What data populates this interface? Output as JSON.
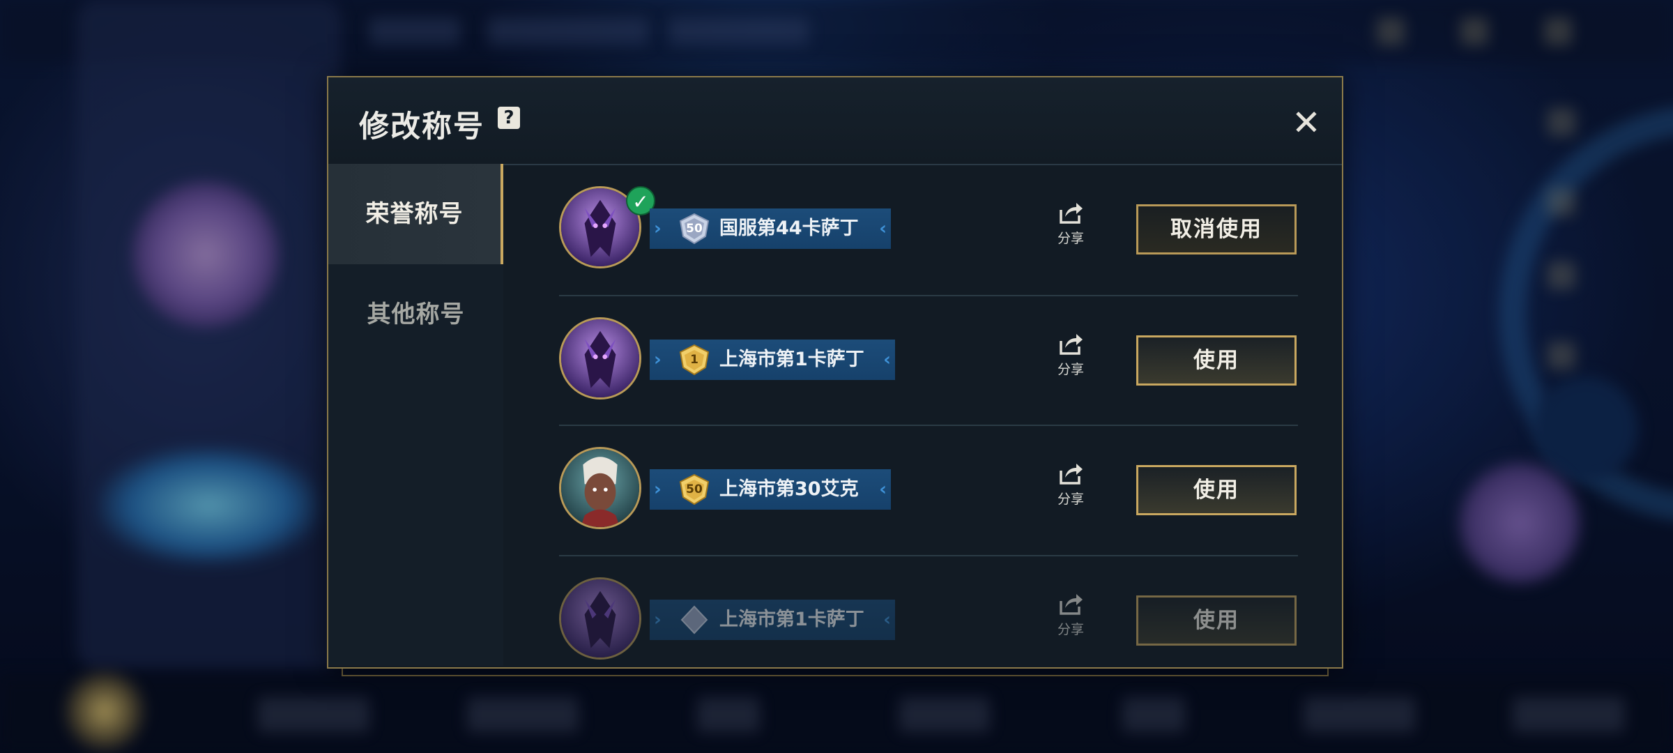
{
  "dialog": {
    "title": "修改称号",
    "help_icon_glyph": "?",
    "close_icon_glyph": "✕"
  },
  "tabs": [
    {
      "label": "荣誉称号",
      "active": true
    },
    {
      "label": "其他称号",
      "active": false
    }
  ],
  "titles": [
    {
      "hero": "kassadin",
      "rank_badge": "silver",
      "rank_number": "50",
      "title": "国服第44卡萨丁",
      "equipped": true,
      "share_label": "分享",
      "button_label": "取消使用"
    },
    {
      "hero": "kassadin",
      "rank_badge": "gold",
      "rank_number": "1",
      "title": "上海市第1卡萨丁",
      "equipped": false,
      "share_label": "分享",
      "button_label": "使用"
    },
    {
      "hero": "ekko",
      "rank_badge": "gold",
      "rank_number": "50",
      "title": "上海市第30艾克",
      "equipped": false,
      "share_label": "分享",
      "button_label": "使用"
    },
    {
      "hero": "kassadin",
      "rank_badge": "silver",
      "rank_number": "",
      "title": "上海市第1卡萨丁",
      "equipped": false,
      "share_label": "分享",
      "button_label": "使用"
    }
  ],
  "icons": {
    "check": "✓",
    "share": "share-icon"
  },
  "colors": {
    "accent_gold": "#c9a860",
    "banner_blue": "#1c4c79",
    "equipped_green": "#1fa35a",
    "dialog_bg": "#121b24"
  }
}
